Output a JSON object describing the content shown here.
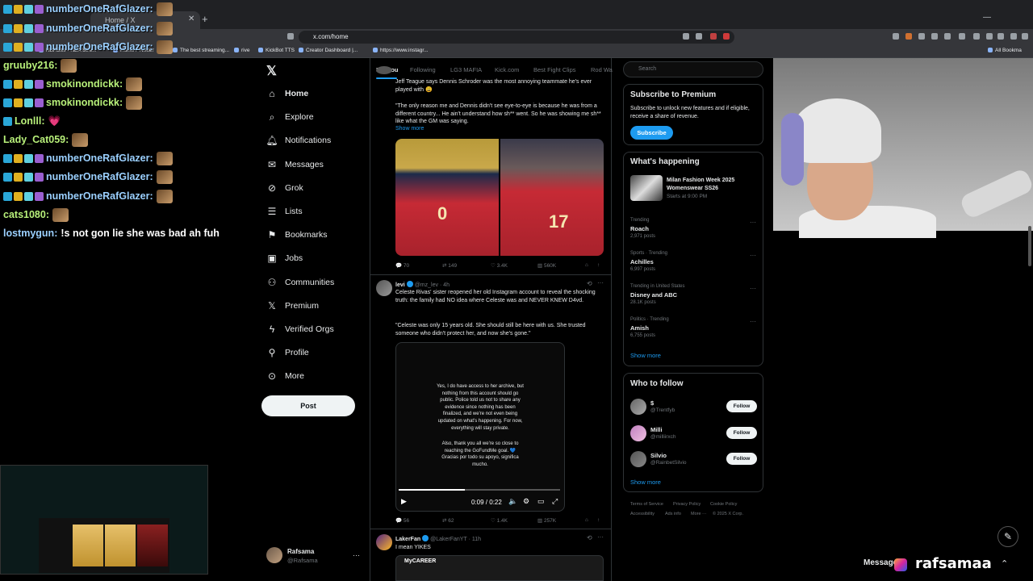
{
  "browser": {
    "tab_title": "Home / X",
    "url": "x.com/home",
    "bookmarks": [
      "NBABite - NBA Stre...",
      "Home / Twitter",
      "The best streaming...",
      "rive",
      "KickBot TTS",
      "Creator Dashboard |...",
      "https://www.instagr...",
      "All Bookma"
    ]
  },
  "chat": [
    {
      "user": "numberOneRafGlazer:",
      "msg": "",
      "color": "blue",
      "badges": 4
    },
    {
      "user": "numberOneRafGlazer:",
      "msg": "",
      "color": "blue",
      "badges": 4
    },
    {
      "user": "numberOneRafGlazer:",
      "msg": "",
      "color": "blue",
      "badges": 4
    },
    {
      "user": "gruuby216:",
      "msg": "",
      "color": "green",
      "badges": 0
    },
    {
      "user": "smokinondickk:",
      "msg": "",
      "color": "green",
      "badges": 4
    },
    {
      "user": "smokinondickk:",
      "msg": "",
      "color": "green",
      "badges": 4
    },
    {
      "user": "Lonlll:",
      "msg": "💗",
      "color": "green",
      "badges": 1
    },
    {
      "user": "Lady_Cat059:",
      "msg": "",
      "color": "green",
      "badges": 0
    },
    {
      "user": "numberOneRafGlazer:",
      "msg": "",
      "color": "blue",
      "badges": 4
    },
    {
      "user": "numberOneRafGlazer:",
      "msg": "",
      "color": "blue",
      "badges": 4
    },
    {
      "user": "numberOneRafGlazer:",
      "msg": "",
      "color": "blue",
      "badges": 4
    },
    {
      "user": "cats1080:",
      "msg": "",
      "color": "green",
      "badges": 0
    },
    {
      "user": "lostmygun:",
      "msg": "!s not gon lie she was bad ah fuh",
      "color": "blue",
      "badges": 0
    }
  ],
  "nav": {
    "items": [
      "Home",
      "Explore",
      "Notifications",
      "Messages",
      "Grok",
      "Lists",
      "Bookmarks",
      "Jobs",
      "Communities",
      "Premium",
      "Verified Orgs",
      "Profile",
      "More"
    ],
    "icons": [
      "home-icon",
      "explore-icon",
      "bell-icon",
      "mail-icon",
      "grok-icon",
      "list-icon",
      "bookmark-icon",
      "briefcase-icon",
      "people-icon",
      "x-icon",
      "lightning-icon",
      "person-icon",
      "more-icon"
    ],
    "post_label": "Post",
    "profile_name": "Rafsama",
    "profile_handle": "@Rafsama"
  },
  "feed": {
    "tabs": [
      "For you",
      "Following",
      "LG3 MAFIA",
      "Kick.com",
      "Best Fight Clips",
      "Rod Wa"
    ],
    "tweet1": {
      "text_top": "Jeff Teague says Dennis Schroder was the most annoying teammate he's ever played with 😩",
      "text_quote": "\"The only reason me and Dennis didn't see eye-to-eye is because he was from a different country... He ain't understand how sh** went. So he was showing me sh** like what the GM was saying.",
      "show_more": "Show more",
      "jersey_left": "0",
      "jersey_right": "17",
      "replies": "70",
      "retweets": "149",
      "likes": "3.4K",
      "views": "560K"
    },
    "tweet2": {
      "name": "levi",
      "handle": "@mz_lev · 4h",
      "text1": "Celeste Rivas' sister reopened her old Instagram account to reveal the shocking truth: the family had NO idea where Celeste was and NEVER KNEW D4vd.",
      "text2": "\"Celeste was only 15 years old. She should still be here with us. She trusted someone who didn't protect her, and now she's gone.\"",
      "video_text1": "Yes, I do have access to her archive, but nothing from this account should go public. Police told us not to share any evidence since nothing has been finalized, and we're not even being updated on what's happening. For now, everything will stay private.",
      "video_text2": "Also, thank you all we're so close to reaching the GoFundMe goal. 💙 Gracias por todo su apoyo, significa mucho.",
      "video_time": "0:09 / 0:22",
      "progress": 0.41,
      "replies": "56",
      "retweets": "62",
      "likes": "1.4K",
      "views": "257K"
    },
    "tweet3": {
      "name": "LakerFan",
      "handle": "@LakerFanYT · 11h",
      "text": "I mean YIKES",
      "card_label": "MyCAREER"
    }
  },
  "right": {
    "search_placeholder": "Search",
    "premium_title": "Subscribe to Premium",
    "premium_desc": "Subscribe to unlock new features and if eligible, receive a share of revenue.",
    "subscribe_label": "Subscribe",
    "happening_title": "What's happening",
    "event_title": "Milan Fashion Week 2025 Womenswear SS26",
    "event_time": "Starts at 9:00 PM",
    "trends": [
      {
        "cat": "Trending",
        "name": "Roach",
        "posts": "2,971 posts"
      },
      {
        "cat": "Sports · Trending",
        "name": "Achilles",
        "posts": "6,997 posts"
      },
      {
        "cat": "Trending in United States",
        "name": "Disney and ABC",
        "posts": "28.1K posts"
      },
      {
        "cat": "Politics · Trending",
        "name": "Amish",
        "posts": "6,755 posts"
      }
    ],
    "show_more": "Show more",
    "wtf_title": "Who to follow",
    "follow_label": "Follow",
    "who_to_follow": [
      {
        "name": "$",
        "handle": "@Trentfyb"
      },
      {
        "name": "Milli",
        "handle": "@milliirxch"
      },
      {
        "name": "Silvio",
        "handle": "@RainbetSilvio"
      }
    ],
    "footer": [
      "Terms of Service",
      "Privacy Policy",
      "Cookie Policy",
      "Accessibility",
      "Ads info",
      "More ···",
      "© 2025 X Corp."
    ]
  },
  "overlay": {
    "messages_label": "Messages",
    "streamer": "rafsamaa"
  },
  "colors": {
    "accent": "#1d9bf0",
    "bg": "#000000",
    "text": "#e7e9ea",
    "muted": "#71767b"
  }
}
